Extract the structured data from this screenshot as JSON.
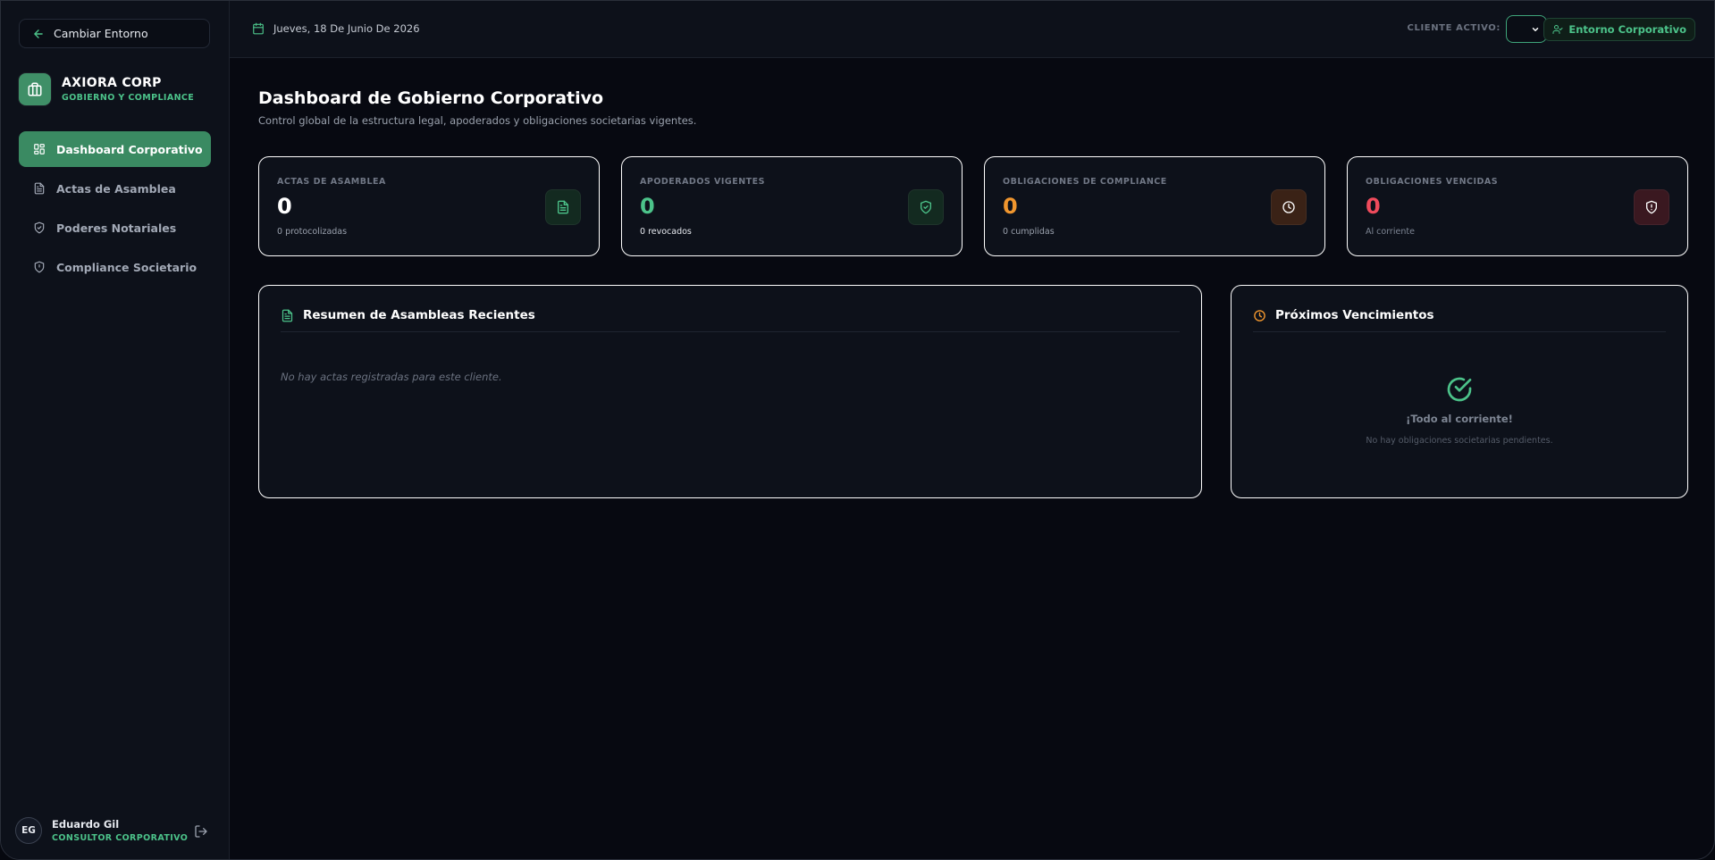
{
  "sidebar": {
    "back_label": "Cambiar Entorno",
    "brand": {
      "name": "AXIORA CORP",
      "subtitle": "GOBIERNO Y COMPLIANCE"
    },
    "items": [
      {
        "label": "Dashboard Corporativo",
        "icon": "dashboard-icon",
        "active": true
      },
      {
        "label": "Actas de Asamblea",
        "icon": "document-icon",
        "active": false
      },
      {
        "label": "Poderes Notariales",
        "icon": "shield-check-icon",
        "active": false
      },
      {
        "label": "Compliance Societario",
        "icon": "shield-icon",
        "active": false
      }
    ],
    "user": {
      "initials": "EG",
      "name": "Eduardo Gil",
      "role": "CONSULTOR CORPORATIVO"
    }
  },
  "topbar": {
    "date": "Jueves, 18 De Junio De 2026",
    "client_label": "CLIENTE ACTIVO:",
    "client_value": "",
    "environment": "Entorno Corporativo"
  },
  "main": {
    "title": "Dashboard de Gobierno Corporativo",
    "subtitle": "Control global de la estructura legal, apoderados y obligaciones societarias vigentes.",
    "stats": [
      {
        "label": "ACTAS DE ASAMBLEA",
        "value": "0",
        "sub": "0 protocolizadas",
        "color": "#ffffff",
        "sub_color": "#9aa1ad",
        "icon": "document-icon",
        "icon_color": "#4cc38a",
        "icon_bg": "#132a20"
      },
      {
        "label": "APODERADOS VIGENTES",
        "value": "0",
        "sub": "0 revocados",
        "color": "#4cc38a",
        "sub_color": "#e6e9ef",
        "icon": "shield-check-icon",
        "icon_color": "#4cc38a",
        "icon_bg": "#132a20"
      },
      {
        "label": "OBLIGACIONES DE COMPLIANCE",
        "value": "0",
        "sub": "0 cumplidas",
        "color": "#f0962e",
        "sub_color": "#9aa1ad",
        "icon": "clock-icon",
        "icon_color": "#ffffff",
        "icon_bg": "#3a2216"
      },
      {
        "label": "OBLIGACIONES VENCIDAS",
        "value": "0",
        "sub": "Al corriente",
        "color": "#ef4b5c",
        "sub_color": "#7d8593",
        "icon": "shield-alert-icon",
        "icon_color": "#ffffff",
        "icon_bg": "#3a1820"
      }
    ],
    "assemblies_panel": {
      "title": "Resumen de Asambleas Recientes",
      "empty": "No hay actas registradas para este cliente."
    },
    "deadlines_panel": {
      "title": "Próximos Vencimientos",
      "ok_title": "¡Todo al corriente!",
      "ok_sub": "No hay obligaciones societarias pendientes."
    }
  }
}
